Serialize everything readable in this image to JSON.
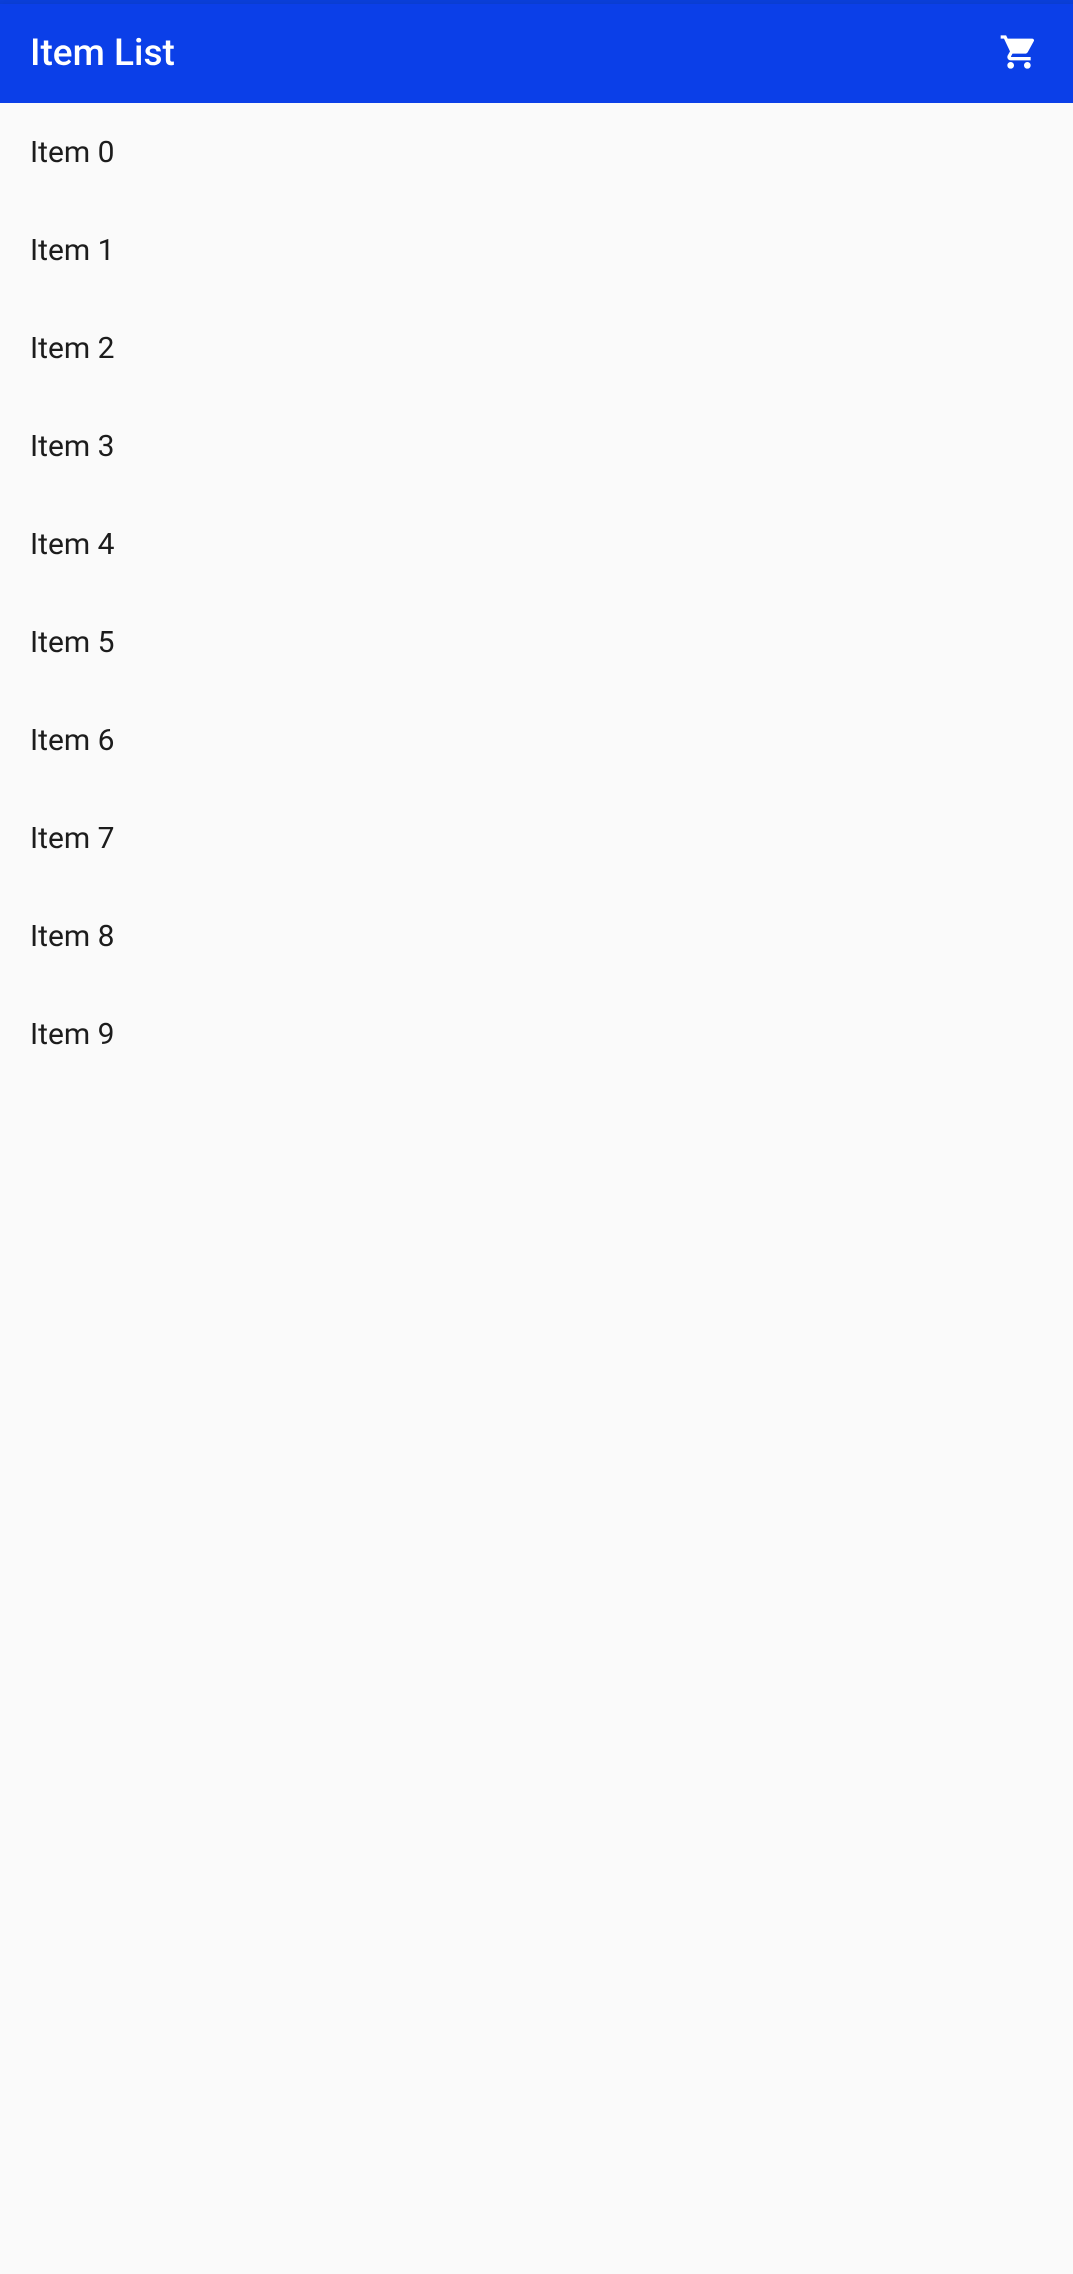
{
  "header": {
    "title": "Item List",
    "cart_icon": "shopping-cart-icon"
  },
  "list": {
    "items": [
      {
        "label": "Item 0"
      },
      {
        "label": "Item 1"
      },
      {
        "label": "Item 2"
      },
      {
        "label": "Item 3"
      },
      {
        "label": "Item 4"
      },
      {
        "label": "Item 5"
      },
      {
        "label": "Item 6"
      },
      {
        "label": "Item 7"
      },
      {
        "label": "Item 8"
      },
      {
        "label": "Item 9"
      }
    ]
  },
  "colors": {
    "primary": "#0b3fe8",
    "status_bar": "#0b3fd8",
    "background": "#fafafa",
    "text": "#1c1c1c",
    "on_primary": "#ffffff"
  }
}
